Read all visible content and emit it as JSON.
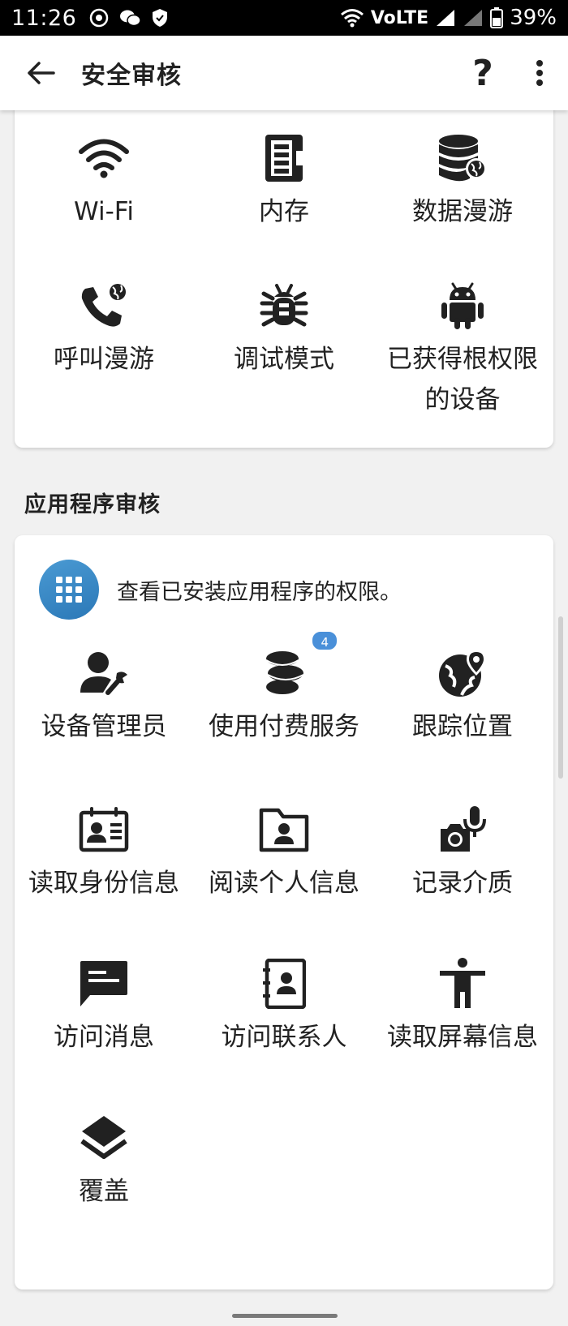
{
  "status_bar": {
    "time": "11:26",
    "battery": "39%",
    "network": "VoLTE"
  },
  "app_bar": {
    "title": "安全审核",
    "help_label": "?"
  },
  "security_items": [
    {
      "label": "Wi-Fi",
      "icon": "wifi-icon"
    },
    {
      "label": "内存",
      "icon": "memory-icon"
    },
    {
      "label": "数据漫游",
      "icon": "data-roaming-icon"
    },
    {
      "label": "呼叫漫游",
      "icon": "call-roaming-icon"
    },
    {
      "label": "调试模式",
      "icon": "bug-icon"
    },
    {
      "label": "已获得根权限的设备",
      "icon": "android-icon"
    }
  ],
  "app_audit": {
    "section_title": "应用程序审核",
    "permissions_text": "查看已安装应用程序的权限。",
    "items": [
      {
        "label": "设备管理员",
        "icon": "admin-icon"
      },
      {
        "label": "使用付费服务",
        "icon": "coins-icon",
        "badge": "4"
      },
      {
        "label": "跟踪位置",
        "icon": "location-globe-icon"
      },
      {
        "label": "读取身份信息",
        "icon": "id-card-icon"
      },
      {
        "label": "阅读个人信息",
        "icon": "personal-folder-icon"
      },
      {
        "label": "记录介质",
        "icon": "camera-mic-icon"
      },
      {
        "label": "访问消息",
        "icon": "message-icon"
      },
      {
        "label": "访问联系人",
        "icon": "contacts-icon"
      },
      {
        "label": "读取屏幕信息",
        "icon": "accessibility-icon"
      },
      {
        "label": "覆盖",
        "icon": "layers-icon"
      }
    ]
  },
  "colors": {
    "accent": "#3b8ac6",
    "badge": "#4a90d9",
    "icon": "#212121",
    "background": "#f1f1f1"
  }
}
